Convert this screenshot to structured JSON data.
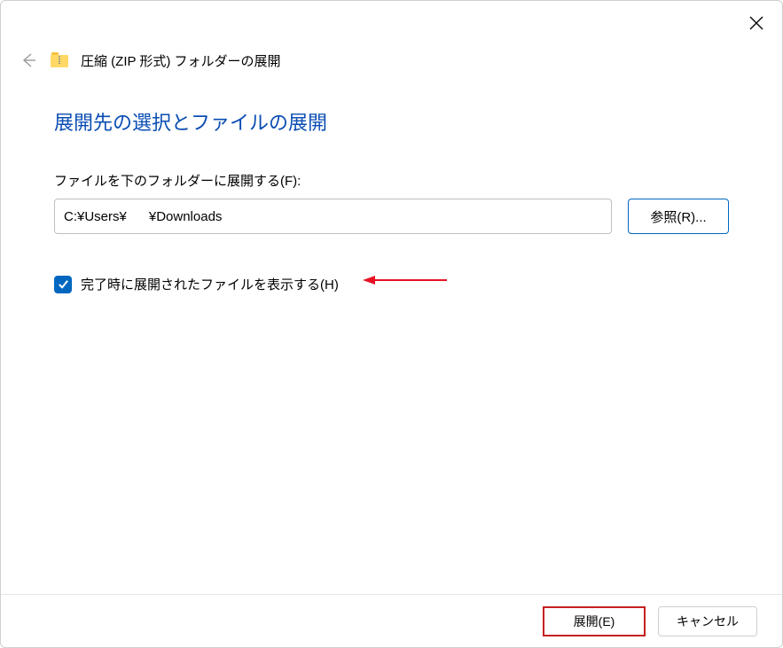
{
  "window": {
    "title": "圧縮 (ZIP 形式) フォルダーの展開"
  },
  "main": {
    "heading": "展開先の選択とファイルの展開",
    "destinationLabel": "ファイルを下のフォルダーに展開する(F):",
    "destinationPath": "C:¥Users¥      ¥Downloads",
    "browseButton": "参照(R)...",
    "showExtractedCheckbox": {
      "checked": true,
      "label": "完了時に展開されたファイルを表示する(H)"
    }
  },
  "footer": {
    "extractButton": "展開(E)",
    "cancelButton": "キャンセル"
  }
}
